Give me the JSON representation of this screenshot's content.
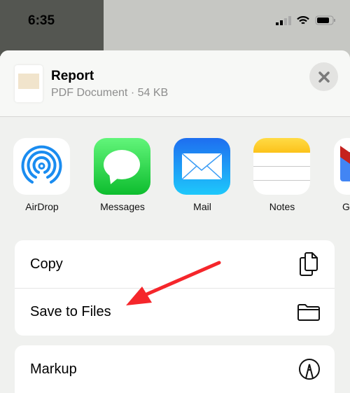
{
  "status_bar": {
    "time": "6:35"
  },
  "header": {
    "title": "Report",
    "subtitle": "PDF Document · 54 KB"
  },
  "apps": [
    {
      "label": "AirDrop",
      "icon": "airdrop-icon"
    },
    {
      "label": "Messages",
      "icon": "messages-icon"
    },
    {
      "label": "Mail",
      "icon": "mail-icon"
    },
    {
      "label": "Notes",
      "icon": "notes-icon"
    },
    {
      "label": "G",
      "icon": "gmail-icon"
    }
  ],
  "actions": [
    {
      "label": "Copy",
      "icon": "copy-icon"
    },
    {
      "label": "Save to Files",
      "icon": "folder-icon"
    },
    {
      "label": "Markup",
      "icon": "markup-icon"
    }
  ],
  "colors": {
    "accent_arrow": "#f5262b"
  }
}
